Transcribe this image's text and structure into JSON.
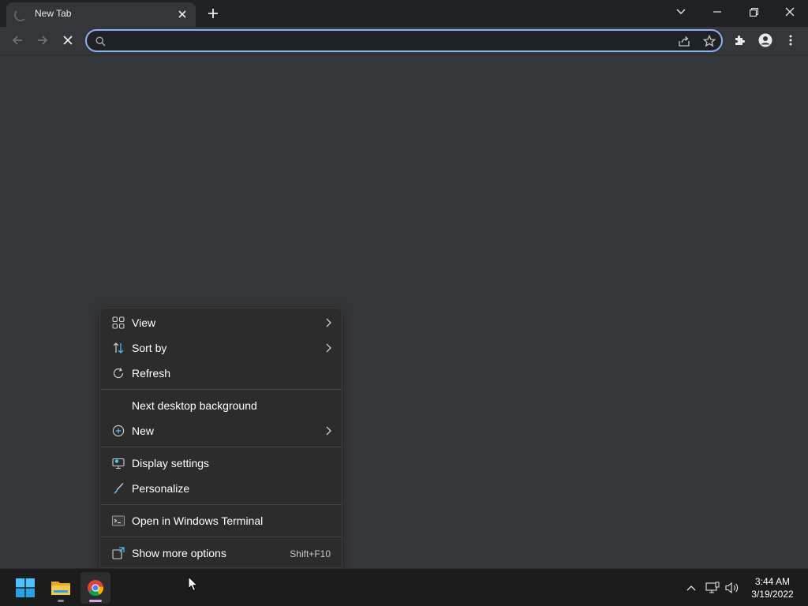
{
  "browser": {
    "tab": {
      "title": "New Tab",
      "icon": "loading-spinner-icon"
    },
    "window_controls": [
      "tab-search-icon",
      "minimize-icon",
      "restore-icon",
      "close-icon"
    ],
    "toolbar": {
      "back_icon": "back-arrow-icon",
      "forward_icon": "forward-arrow-icon",
      "stop_icon": "stop-loading-icon",
      "omnibox": {
        "value": "",
        "placeholder": ""
      },
      "omnibox_icons": [
        "share-icon",
        "bookmark-star-icon"
      ],
      "extension_icons": [
        "extensions-puzzle-icon",
        "profile-icon",
        "menu-kebab-icon"
      ]
    },
    "accent_color": "#8ab4f8"
  },
  "context_menu": {
    "items": [
      {
        "label": "View",
        "icon": "grid-view-icon",
        "submenu": true
      },
      {
        "label": "Sort by",
        "icon": "sort-icon",
        "submenu": true
      },
      {
        "label": "Refresh",
        "icon": "refresh-icon",
        "submenu": false
      },
      {
        "label": "Next desktop background",
        "icon": "",
        "submenu": false
      },
      {
        "label": "New",
        "icon": "plus-circle-icon",
        "submenu": true
      },
      {
        "label": "Display settings",
        "icon": "display-icon",
        "submenu": false
      },
      {
        "label": "Personalize",
        "icon": "brush-icon",
        "submenu": false
      },
      {
        "label": "Open in Windows Terminal",
        "icon": "terminal-icon",
        "submenu": false
      },
      {
        "label": "Show more options",
        "icon": "more-options-icon",
        "shortcut": "Shift+F10",
        "submenu": false
      }
    ]
  },
  "taskbar": {
    "apps": [
      {
        "name": "Start",
        "icon": "windows-start-icon"
      },
      {
        "name": "File Explorer",
        "icon": "file-explorer-icon"
      },
      {
        "name": "Google Chrome",
        "icon": "chrome-icon",
        "active": true
      }
    ],
    "tray": [
      "chevron-up-icon",
      "network-icon",
      "volume-icon"
    ],
    "clock": {
      "time": "3:44 AM",
      "date": "3/19/2022"
    }
  }
}
